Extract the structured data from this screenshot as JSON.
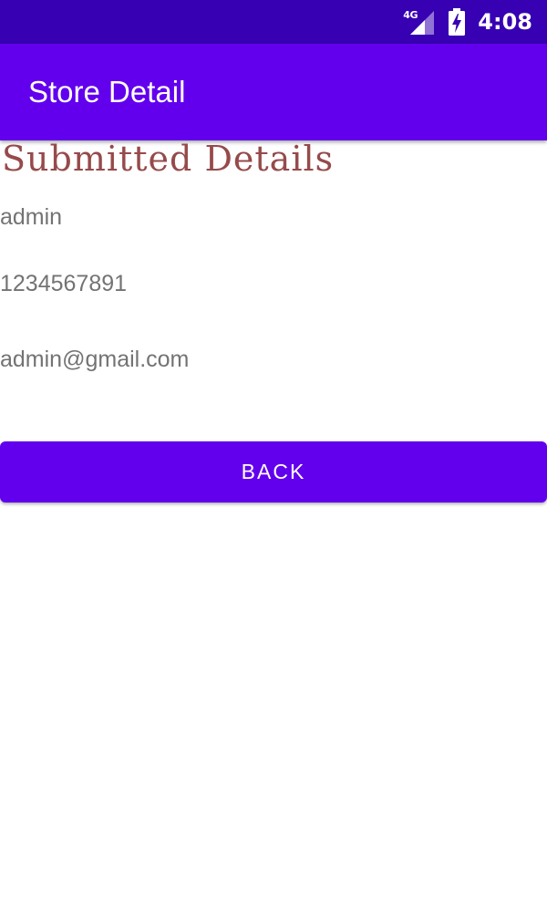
{
  "status_bar": {
    "network_label": "4G",
    "time": "4:08",
    "icons": [
      "signal-icon",
      "battery-charging-icon"
    ]
  },
  "app_bar": {
    "title": "Store Detail"
  },
  "content": {
    "heading": "Submitted Details",
    "name": "admin",
    "phone": "1234567891",
    "email": "admin@gmail.com"
  },
  "actions": {
    "back_label": "BACK"
  },
  "colors": {
    "status_bar": "#3700b3",
    "primary": "#6200ee",
    "heading": "#964a4a",
    "body_text": "#737373"
  }
}
